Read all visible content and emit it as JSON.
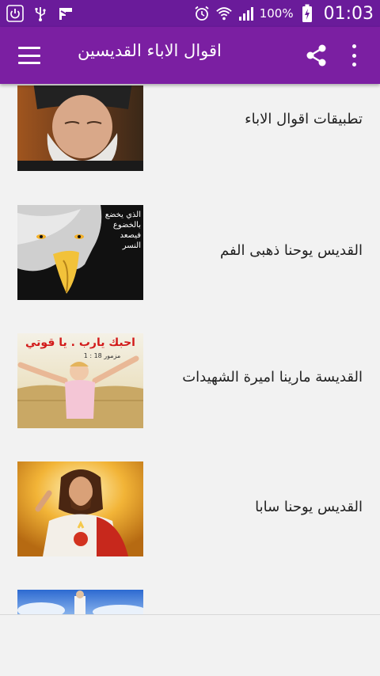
{
  "status_bar": {
    "battery_percent": "100%",
    "time": "01:03",
    "icons": [
      "power-icon",
      "usb-icon",
      "flipboard-icon",
      "alarm-icon",
      "wifi-icon",
      "signal-icon",
      "battery-charging-icon"
    ]
  },
  "app_bar": {
    "title": "اقوال الاباء القديسين",
    "icons": [
      "menu-icon",
      "share-icon",
      "more-vert-icon"
    ]
  },
  "items": [
    {
      "label": "تطبيقات اقوال الاباء",
      "image": "portrait of bearded elderly man in black cap"
    },
    {
      "label": "القديس يوحنا ذهبى الفم",
      "image": "eagle face with white arabic text",
      "image_text": [
        "الذي يخضع",
        "بالخضوع",
        "فيصعد",
        "النسر"
      ]
    },
    {
      "label": "القديسة مارينا اميرة الشهيدات",
      "image": "child with open arms in wheat field",
      "image_text": [
        "احبك يارب . يا قوتي",
        "مزمور 18 : 1"
      ]
    },
    {
      "label": "القديس يوحنا سابا",
      "image": "icon of Jesus with sacred heart"
    },
    {
      "label": "",
      "image": "figure in white on blue sky"
    }
  ],
  "colors": {
    "status_bar": "#6a1b9a",
    "app_bar": "#7b1fa2",
    "background": "#f2f2f2",
    "text": "#222222"
  }
}
